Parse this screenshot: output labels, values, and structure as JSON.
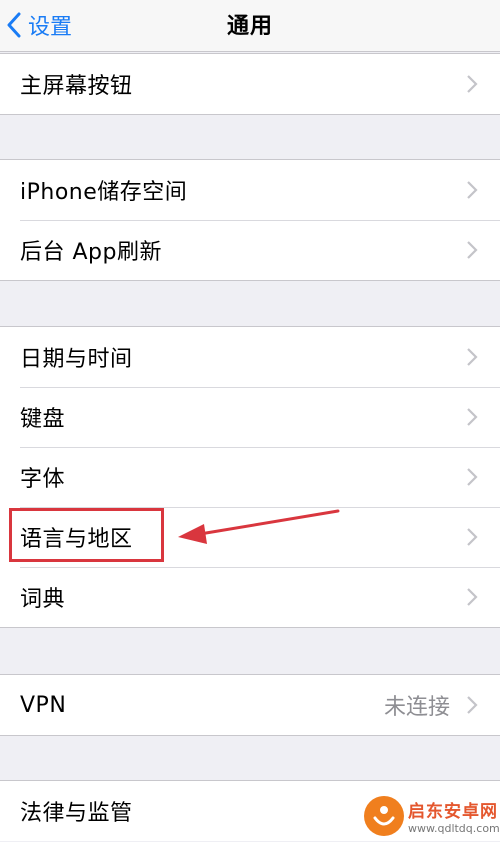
{
  "navbar": {
    "back_label": "设置",
    "title": "通用"
  },
  "groups": [
    {
      "rows": [
        {
          "label": "主屏幕按钮"
        }
      ]
    },
    {
      "rows": [
        {
          "label": "iPhone储存空间"
        },
        {
          "label": "后台 App刷新"
        }
      ]
    },
    {
      "rows": [
        {
          "label": "日期与时间"
        },
        {
          "label": "键盘"
        },
        {
          "label": "字体"
        },
        {
          "label": "语言与地区"
        },
        {
          "label": "词典"
        }
      ]
    },
    {
      "rows": [
        {
          "label": "VPN",
          "value": "未连接"
        }
      ]
    },
    {
      "rows": [
        {
          "label": "法律与监管"
        }
      ]
    }
  ],
  "watermark": {
    "name": "启东安卓网",
    "url": "www.qdltdq.com"
  },
  "colors": {
    "accent": "#1a7cf5",
    "annotation": "#d9363e",
    "chevron": "#c4c4c9"
  }
}
